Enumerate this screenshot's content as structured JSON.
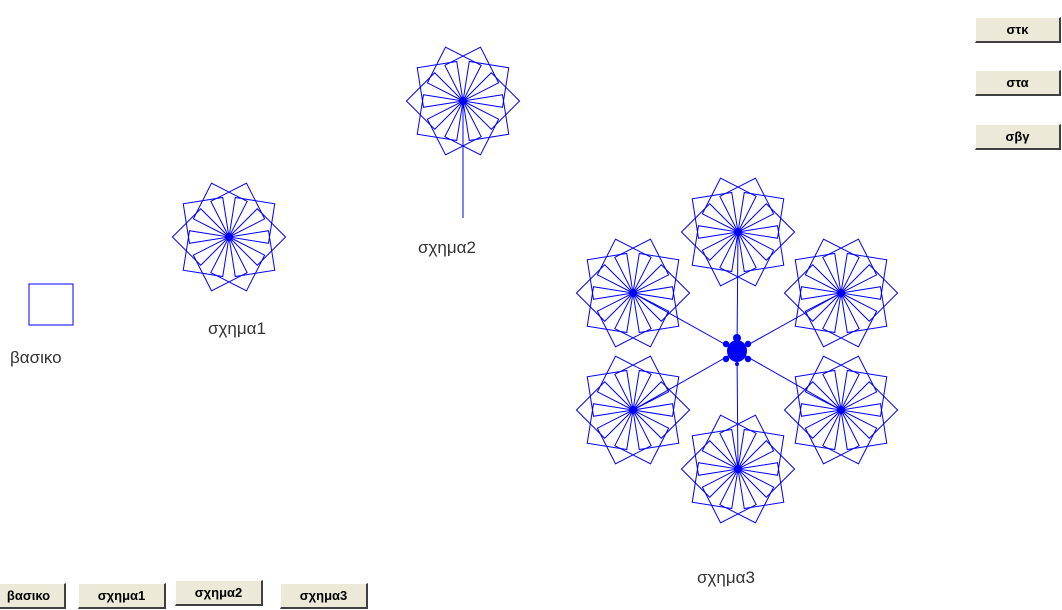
{
  "labels": {
    "basic": "βασικο",
    "shape1": "σχημα1",
    "shape2": "σχημα2",
    "shape3": "σχημα3"
  },
  "buttons": {
    "bottom": [
      "βασικο",
      "σχημα1",
      "σχημα2",
      "σχημα3"
    ],
    "right": [
      "στκ",
      "στα",
      "σβγ"
    ]
  },
  "colors": {
    "stroke": "#0000ff",
    "label": "#333333",
    "button_face": "#ece9d8"
  },
  "icons": {
    "turtle": "turtle-icon"
  }
}
